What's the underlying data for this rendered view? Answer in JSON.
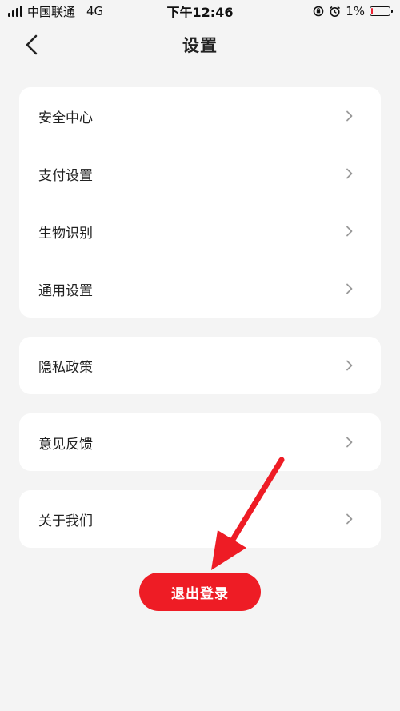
{
  "status_bar": {
    "carrier": "中国联通",
    "network": "4G",
    "time": "下午12:46",
    "battery_percent": "1%",
    "battery_level": 0.01,
    "icons": [
      "signal-icon",
      "rotation-lock-icon",
      "alarm-icon",
      "battery-icon"
    ]
  },
  "header": {
    "title": "设置",
    "back_icon": "chevron-left-icon"
  },
  "groups": [
    {
      "items": [
        {
          "label": "安全中心"
        },
        {
          "label": "支付设置"
        },
        {
          "label": "生物识别"
        },
        {
          "label": "通用设置"
        }
      ]
    },
    {
      "items": [
        {
          "label": "隐私政策"
        }
      ]
    },
    {
      "items": [
        {
          "label": "意见反馈"
        }
      ]
    },
    {
      "items": [
        {
          "label": "关于我们"
        }
      ]
    }
  ],
  "logout_button": {
    "label": "退出登录"
  },
  "colors": {
    "background": "#f4f4f4",
    "card": "#ffffff",
    "accent": "#ee1c25",
    "text": "#222222",
    "chevron": "#999999"
  }
}
